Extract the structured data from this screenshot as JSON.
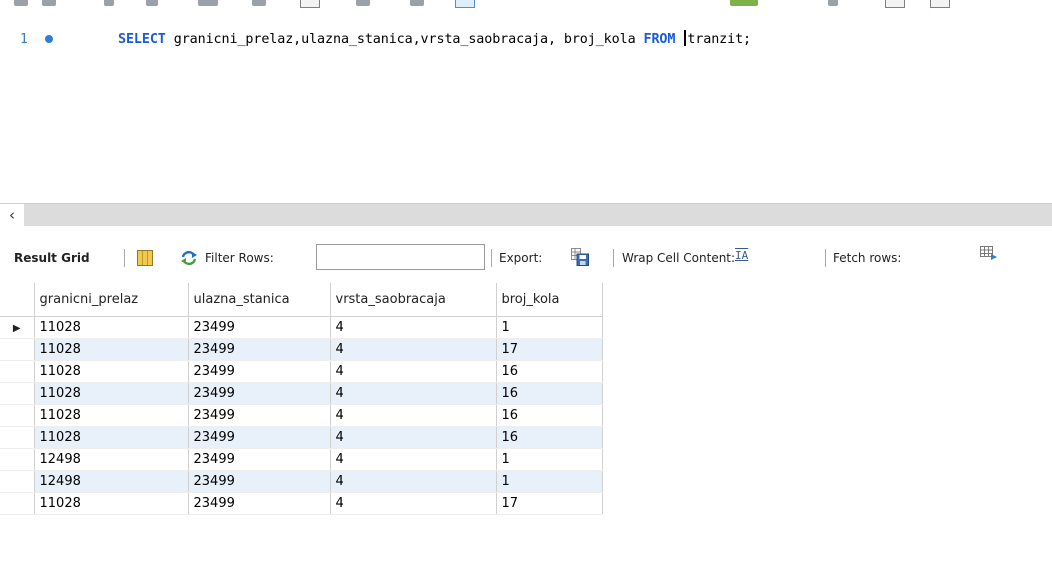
{
  "editor": {
    "line_number": "1",
    "sql_keyword_select": "SELECT",
    "sql_columns": " granicni_prelaz,ulazna_stanica,vrsta_saobracaja, broj_kola ",
    "sql_keyword_from": "FROM",
    "sql_table": "tranzit;"
  },
  "result_toolbar": {
    "result_grid_label": "Result Grid",
    "filter_label": "Filter Rows:",
    "filter_value": "",
    "export_label": "Export:",
    "wrap_label": "Wrap Cell Content:",
    "wrap_icon_glyph": "IA",
    "fetch_label": "Fetch rows:"
  },
  "table": {
    "columns": [
      "granicni_prelaz",
      "ulazna_stanica",
      "vrsta_saobracaja",
      "broj_kola"
    ],
    "rows": [
      [
        "11028",
        "23499",
        "4",
        "1"
      ],
      [
        "11028",
        "23499",
        "4",
        "17"
      ],
      [
        "11028",
        "23499",
        "4",
        "16"
      ],
      [
        "11028",
        "23499",
        "4",
        "16"
      ],
      [
        "11028",
        "23499",
        "4",
        "16"
      ],
      [
        "11028",
        "23499",
        "4",
        "16"
      ],
      [
        "12498",
        "23499",
        "4",
        "1"
      ],
      [
        "12498",
        "23499",
        "4",
        "1"
      ],
      [
        "11028",
        "23499",
        "4",
        "17"
      ]
    ],
    "current_row_marker": "▶"
  },
  "colors": {
    "keyword": "#1a5bd6",
    "row_alt": "#e8f0fa",
    "line_dot": "#2f7fd0"
  }
}
